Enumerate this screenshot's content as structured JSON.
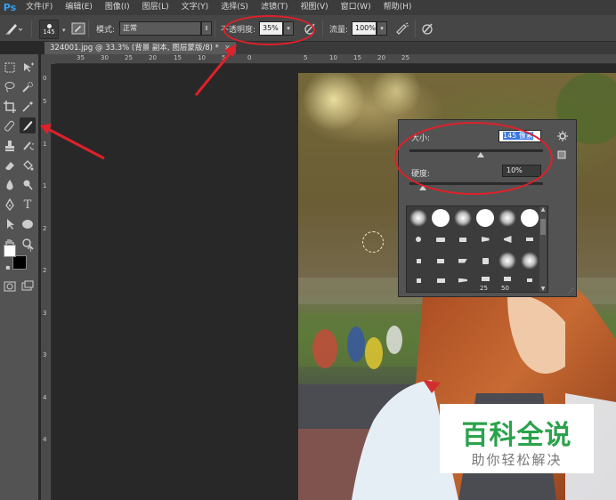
{
  "app": {
    "logo_text": "Ps"
  },
  "menu": [
    "文件(F)",
    "编辑(E)",
    "图像(I)",
    "图层(L)",
    "文字(Y)",
    "选择(S)",
    "滤镜(T)",
    "视图(V)",
    "窗口(W)",
    "帮助(H)"
  ],
  "options": {
    "brush_size": "145",
    "mode_label": "模式:",
    "mode_value": "正常",
    "opacity_label": "不透明度:",
    "opacity_value": "35%",
    "flow_label": "流量:",
    "flow_value": "100%"
  },
  "document_tab": {
    "title": "324001.jpg @ 33.3% (背景 副本, 图层蒙版/8) *",
    "close": "×"
  },
  "ruler_top": [
    "35",
    "30",
    "25",
    "20",
    "15",
    "10",
    "5",
    "0",
    "5",
    "10",
    "15",
    "20",
    "25"
  ],
  "ruler_left": [
    "0",
    "5",
    "1",
    "1",
    "2",
    "2",
    "3",
    "3",
    "4",
    "4"
  ],
  "brush_panel": {
    "size_label": "大小:",
    "size_value": "145 像素",
    "hardness_label": "硬度:",
    "hardness_value": "10%",
    "size_fraction": 0.53,
    "hardness_fraction": 0.1,
    "brush_numbers": [
      "25",
      "50"
    ]
  },
  "watermark": {
    "main": "百科全说",
    "sub": "助你轻松解决"
  },
  "colors": {
    "annotation": "#e0202a",
    "watermark_green": "#2ba24c",
    "foreground": "#ffffff",
    "background": "#000000"
  }
}
